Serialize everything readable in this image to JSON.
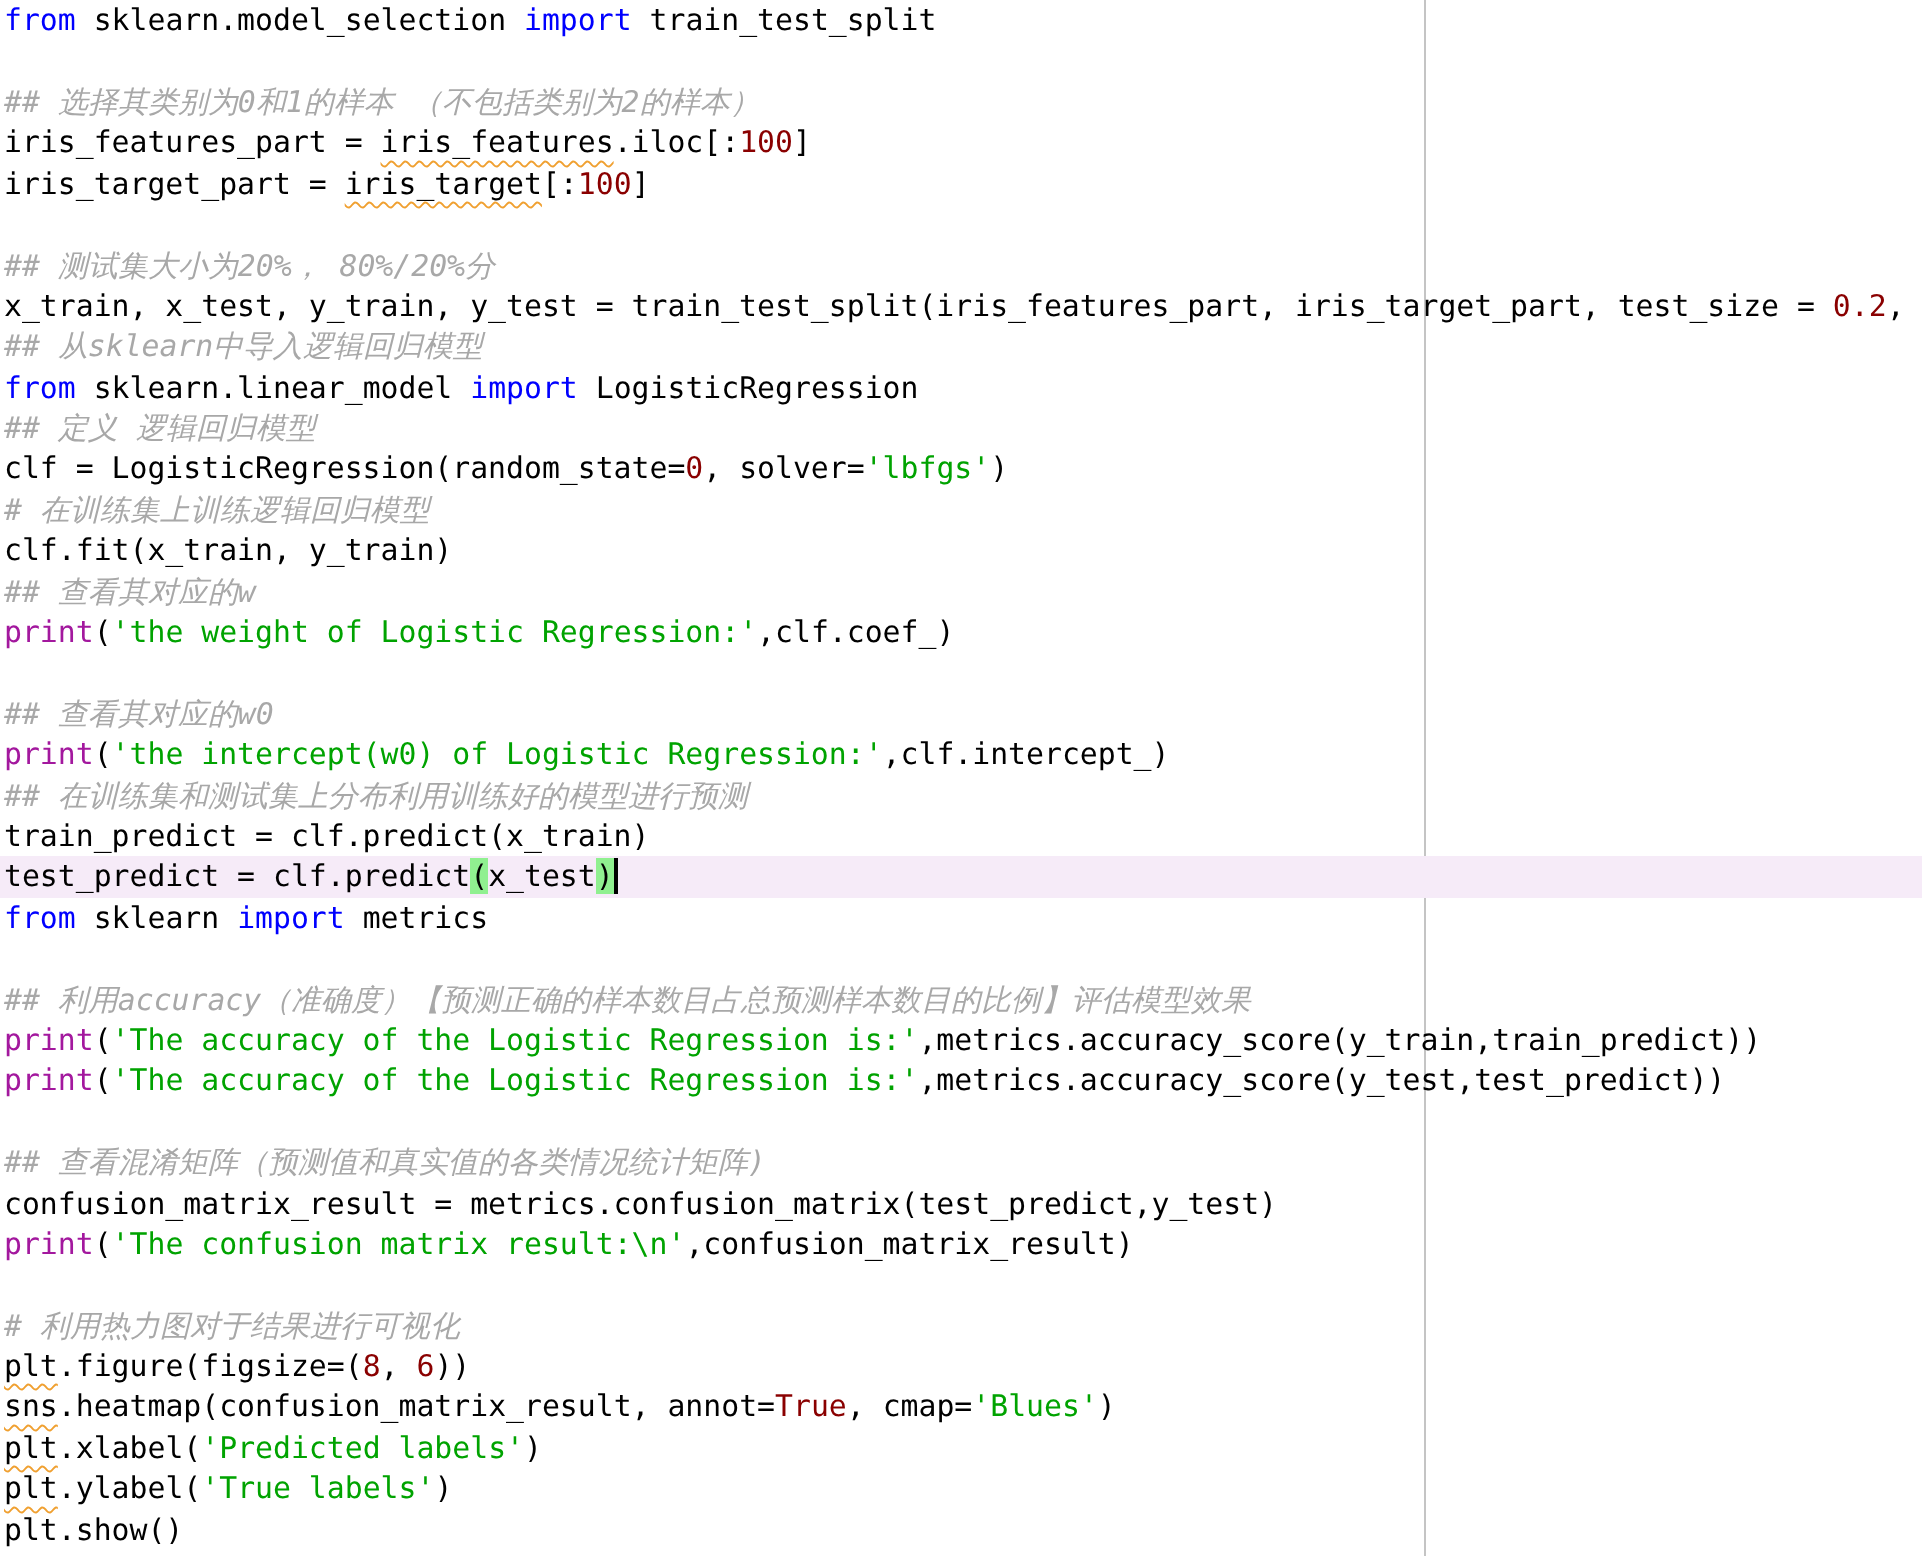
{
  "editor": {
    "lines": [
      {
        "kind": "code",
        "current": false,
        "tokens": [
          {
            "kind": "keyword",
            "text": "from"
          },
          {
            "kind": "plain",
            "text": " sklearn.model_selection "
          },
          {
            "kind": "keyword",
            "text": "import"
          },
          {
            "kind": "plain",
            "text": " train_test_split"
          }
        ]
      },
      {
        "kind": "blank"
      },
      {
        "kind": "code",
        "current": false,
        "tokens": [
          {
            "kind": "comment",
            "text": "## 选择其类别为0和1的样本 （不包括类别为2的样本）"
          }
        ]
      },
      {
        "kind": "code",
        "current": false,
        "tokens": [
          {
            "kind": "plain",
            "text": "iris_features_part = "
          },
          {
            "kind": "flagged",
            "text": "iris_features"
          },
          {
            "kind": "plain",
            "text": ".iloc[:"
          },
          {
            "kind": "number",
            "text": "100"
          },
          {
            "kind": "plain",
            "text": "]"
          }
        ]
      },
      {
        "kind": "code",
        "current": false,
        "tokens": [
          {
            "kind": "plain",
            "text": "iris_target_part = "
          },
          {
            "kind": "flagged",
            "text": "iris_target"
          },
          {
            "kind": "plain",
            "text": "[:"
          },
          {
            "kind": "number",
            "text": "100"
          },
          {
            "kind": "plain",
            "text": "]"
          }
        ]
      },
      {
        "kind": "blank"
      },
      {
        "kind": "code",
        "current": false,
        "tokens": [
          {
            "kind": "comment",
            "text": "## 测试集大小为20%， 80%/20%分"
          }
        ]
      },
      {
        "kind": "code",
        "current": false,
        "tokens": [
          {
            "kind": "plain",
            "text": "x_train, x_test, y_train, y_test = train_test_split(iris_features_part, iris_target_part, test_size = "
          },
          {
            "kind": "number",
            "text": "0.2"
          },
          {
            "kind": "plain",
            "text": ","
          }
        ]
      },
      {
        "kind": "code",
        "current": false,
        "tokens": [
          {
            "kind": "comment",
            "text": "## 从sklearn中导入逻辑回归模型"
          }
        ]
      },
      {
        "kind": "code",
        "current": false,
        "tokens": [
          {
            "kind": "keyword",
            "text": "from"
          },
          {
            "kind": "plain",
            "text": " sklearn.linear_model "
          },
          {
            "kind": "keyword",
            "text": "import"
          },
          {
            "kind": "plain",
            "text": " LogisticRegression"
          }
        ]
      },
      {
        "kind": "code",
        "current": false,
        "tokens": [
          {
            "kind": "comment",
            "text": "## 定义 逻辑回归模型"
          }
        ]
      },
      {
        "kind": "code",
        "current": false,
        "tokens": [
          {
            "kind": "plain",
            "text": "clf = LogisticRegression(random_state="
          },
          {
            "kind": "number",
            "text": "0"
          },
          {
            "kind": "plain",
            "text": ", solver="
          },
          {
            "kind": "string",
            "text": "'lbfgs'"
          },
          {
            "kind": "plain",
            "text": ")"
          }
        ]
      },
      {
        "kind": "code",
        "current": false,
        "tokens": [
          {
            "kind": "comment",
            "text": "# 在训练集上训练逻辑回归模型"
          }
        ]
      },
      {
        "kind": "code",
        "current": false,
        "tokens": [
          {
            "kind": "plain",
            "text": "clf.fit(x_train, y_train)"
          }
        ]
      },
      {
        "kind": "code",
        "current": false,
        "tokens": [
          {
            "kind": "comment",
            "text": "## 查看其对应的w"
          }
        ]
      },
      {
        "kind": "code",
        "current": false,
        "tokens": [
          {
            "kind": "builtin",
            "text": "print"
          },
          {
            "kind": "plain",
            "text": "("
          },
          {
            "kind": "string",
            "text": "'the weight of Logistic Regression:'"
          },
          {
            "kind": "plain",
            "text": ",clf.coef_)"
          }
        ]
      },
      {
        "kind": "blank"
      },
      {
        "kind": "code",
        "current": false,
        "tokens": [
          {
            "kind": "comment",
            "text": "## 查看其对应的w0"
          }
        ]
      },
      {
        "kind": "code",
        "current": false,
        "tokens": [
          {
            "kind": "builtin",
            "text": "print"
          },
          {
            "kind": "plain",
            "text": "("
          },
          {
            "kind": "string",
            "text": "'the intercept(w0) of Logistic Regression:'"
          },
          {
            "kind": "plain",
            "text": ",clf.intercept_)"
          }
        ]
      },
      {
        "kind": "code",
        "current": false,
        "tokens": [
          {
            "kind": "comment",
            "text": "## 在训练集和测试集上分布利用训练好的模型进行预测"
          }
        ]
      },
      {
        "kind": "code",
        "current": false,
        "tokens": [
          {
            "kind": "plain",
            "text": "train_predict = clf.predict(x_train)"
          }
        ]
      },
      {
        "kind": "code",
        "current": true,
        "tokens": [
          {
            "kind": "plain",
            "text": "test_predict = clf.predict"
          },
          {
            "kind": "match",
            "text": "("
          },
          {
            "kind": "plain",
            "text": "x_test"
          },
          {
            "kind": "match",
            "text": ")"
          }
        ]
      },
      {
        "kind": "code",
        "current": false,
        "tokens": [
          {
            "kind": "keyword",
            "text": "from"
          },
          {
            "kind": "plain",
            "text": " sklearn "
          },
          {
            "kind": "keyword",
            "text": "import"
          },
          {
            "kind": "plain",
            "text": " metrics"
          }
        ]
      },
      {
        "kind": "blank"
      },
      {
        "kind": "code",
        "current": false,
        "tokens": [
          {
            "kind": "comment",
            "text": "## 利用accuracy（准确度）【预测正确的样本数目占总预测样本数目的比例】评估模型效果"
          }
        ]
      },
      {
        "kind": "code",
        "current": false,
        "tokens": [
          {
            "kind": "builtin",
            "text": "print"
          },
          {
            "kind": "plain",
            "text": "("
          },
          {
            "kind": "string",
            "text": "'The accuracy of the Logistic Regression is:'"
          },
          {
            "kind": "plain",
            "text": ",metrics.accuracy_score(y_train,train_predict))"
          }
        ]
      },
      {
        "kind": "code",
        "current": false,
        "tokens": [
          {
            "kind": "builtin",
            "text": "print"
          },
          {
            "kind": "plain",
            "text": "("
          },
          {
            "kind": "string",
            "text": "'The accuracy of the Logistic Regression is:'"
          },
          {
            "kind": "plain",
            "text": ",metrics.accuracy_score(y_test,test_predict))"
          }
        ]
      },
      {
        "kind": "blank"
      },
      {
        "kind": "code",
        "current": false,
        "tokens": [
          {
            "kind": "comment",
            "text": "## 查看混淆矩阵（预测值和真实值的各类情况统计矩阵)"
          }
        ]
      },
      {
        "kind": "code",
        "current": false,
        "tokens": [
          {
            "kind": "plain",
            "text": "confusion_matrix_result = metrics.confusion_matrix(test_predict,y_test)"
          }
        ]
      },
      {
        "kind": "code",
        "current": false,
        "tokens": [
          {
            "kind": "builtin",
            "text": "print"
          },
          {
            "kind": "plain",
            "text": "("
          },
          {
            "kind": "string",
            "text": "'The confusion matrix result:\\n'"
          },
          {
            "kind": "plain",
            "text": ",confusion_matrix_result)"
          }
        ]
      },
      {
        "kind": "blank"
      },
      {
        "kind": "code",
        "current": false,
        "tokens": [
          {
            "kind": "comment",
            "text": "# 利用热力图对于结果进行可视化"
          }
        ]
      },
      {
        "kind": "code",
        "current": false,
        "tokens": [
          {
            "kind": "flagged",
            "text": "plt"
          },
          {
            "kind": "plain",
            "text": ".figure(figsize=("
          },
          {
            "kind": "number",
            "text": "8"
          },
          {
            "kind": "plain",
            "text": ", "
          },
          {
            "kind": "number",
            "text": "6"
          },
          {
            "kind": "plain",
            "text": "))"
          }
        ]
      },
      {
        "kind": "code",
        "current": false,
        "tokens": [
          {
            "kind": "flagged",
            "text": "sns"
          },
          {
            "kind": "plain",
            "text": ".heatmap(confusion_matrix_result, annot="
          },
          {
            "kind": "number",
            "text": "True"
          },
          {
            "kind": "plain",
            "text": ", cmap="
          },
          {
            "kind": "string",
            "text": "'Blues'"
          },
          {
            "kind": "plain",
            "text": ")"
          }
        ]
      },
      {
        "kind": "code",
        "current": false,
        "tokens": [
          {
            "kind": "flagged",
            "text": "plt"
          },
          {
            "kind": "plain",
            "text": ".xlabel("
          },
          {
            "kind": "string",
            "text": "'Predicted labels'"
          },
          {
            "kind": "plain",
            "text": ")"
          }
        ]
      },
      {
        "kind": "code",
        "current": false,
        "tokens": [
          {
            "kind": "flagged",
            "text": "plt"
          },
          {
            "kind": "plain",
            "text": ".ylabel("
          },
          {
            "kind": "string",
            "text": "'True labels'"
          },
          {
            "kind": "plain",
            "text": ")"
          }
        ]
      },
      {
        "kind": "code",
        "current": false,
        "tokens": [
          {
            "kind": "plain",
            "text": "plt.show()"
          }
        ]
      }
    ]
  }
}
